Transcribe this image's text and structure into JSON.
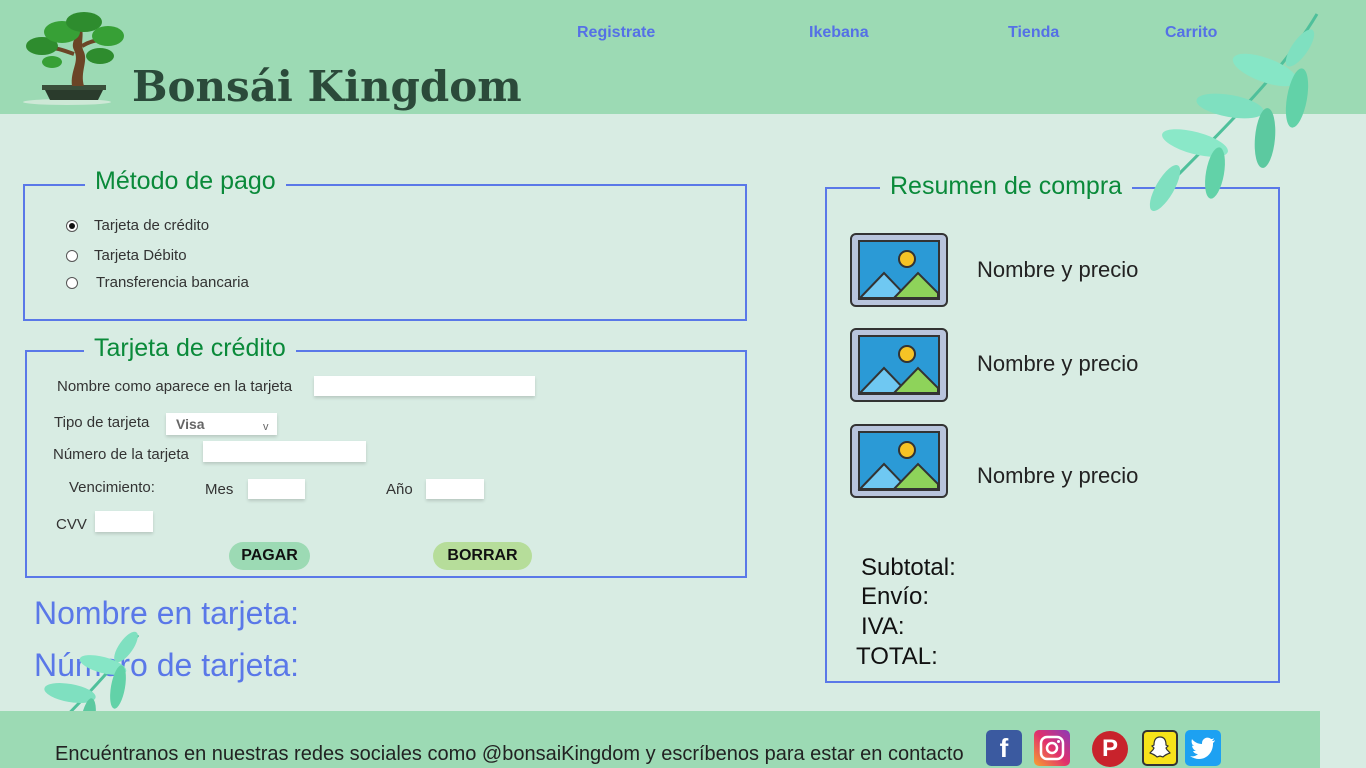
{
  "header": {
    "brand": "Bonsái Kingdom",
    "nav": [
      "Registrate",
      "Ikebana",
      "Tienda",
      "Carrito"
    ]
  },
  "payment_method": {
    "legend": "Método de pago",
    "options": [
      "Tarjeta de crédito",
      "Tarjeta Débito",
      "Transferencia bancaria"
    ],
    "selected": "Tarjeta de crédito"
  },
  "card_form": {
    "legend": "Tarjeta de crédito",
    "name_label": "Nombre como aparece en la tarjeta",
    "type_label": "Tipo de tarjeta",
    "type_value": "Visa",
    "type_arrow": "v",
    "number_label": "Número de la tarjeta",
    "expiry_label": "Vencimiento:",
    "month_label": "Mes",
    "year_label": "Año",
    "cvv_label": "CVV",
    "pay_button": "PAGAR",
    "clear_button": "BORRAR"
  },
  "card_preview": {
    "name_label": "Nombre en tarjeta:",
    "number_label": "Número de tarjeta:"
  },
  "summary": {
    "legend": "Resumen de compra",
    "items": [
      "Nombre y precio",
      "Nombre y precio",
      "Nombre y precio"
    ],
    "subtotal": "Subtotal:",
    "shipping": "Envío:",
    "tax": "IVA:",
    "total": "TOTAL:"
  },
  "footer": {
    "text": "Encuéntranos en nuestras redes sociales como @bonsaiKingdom y escríbenos para estar en contacto",
    "social_icons": [
      "facebook-icon",
      "instagram-icon",
      "pinterest-icon",
      "snapchat-icon",
      "twitter-icon"
    ]
  },
  "colors": {
    "header_bg": "#9cdab4",
    "page_bg": "#d8ece3",
    "nav_link": "#5570e6",
    "legend_green": "#0a8a3a",
    "box_border": "#5a78e8",
    "pay_button": "#9cdab4",
    "clear_button": "#b6dd9a"
  }
}
